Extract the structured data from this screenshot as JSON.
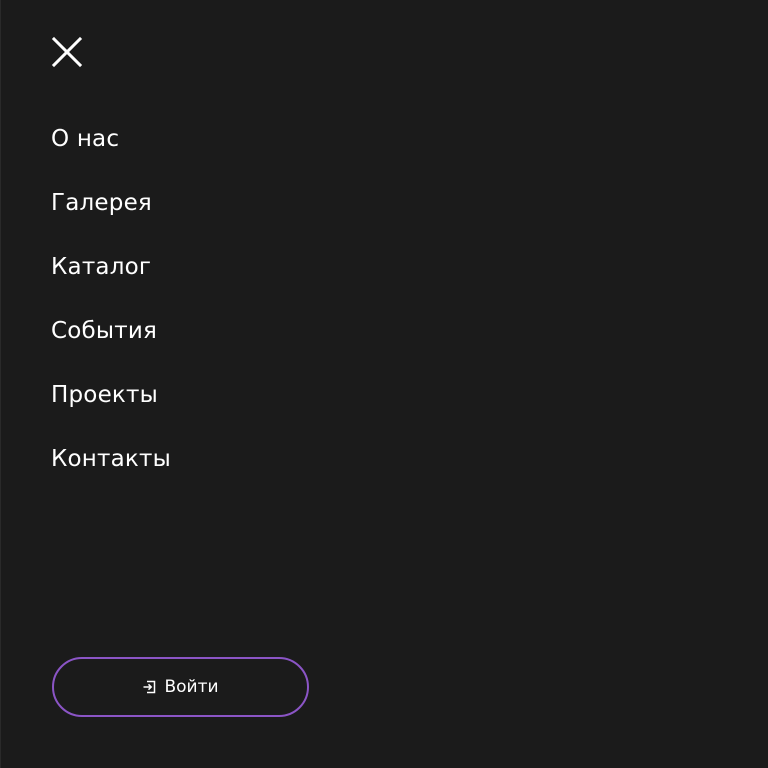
{
  "menu": {
    "items": [
      {
        "label": "О нас"
      },
      {
        "label": "Галерея"
      },
      {
        "label": "Каталог"
      },
      {
        "label": "События"
      },
      {
        "label": "Проекты"
      },
      {
        "label": "Контакты"
      }
    ],
    "close_icon": "close-icon"
  },
  "login": {
    "label": "Войти",
    "icon": "login-icon",
    "border_color": "#8b55c6"
  },
  "theme": {
    "background": "#1b1b1b",
    "text": "#ffffff"
  }
}
